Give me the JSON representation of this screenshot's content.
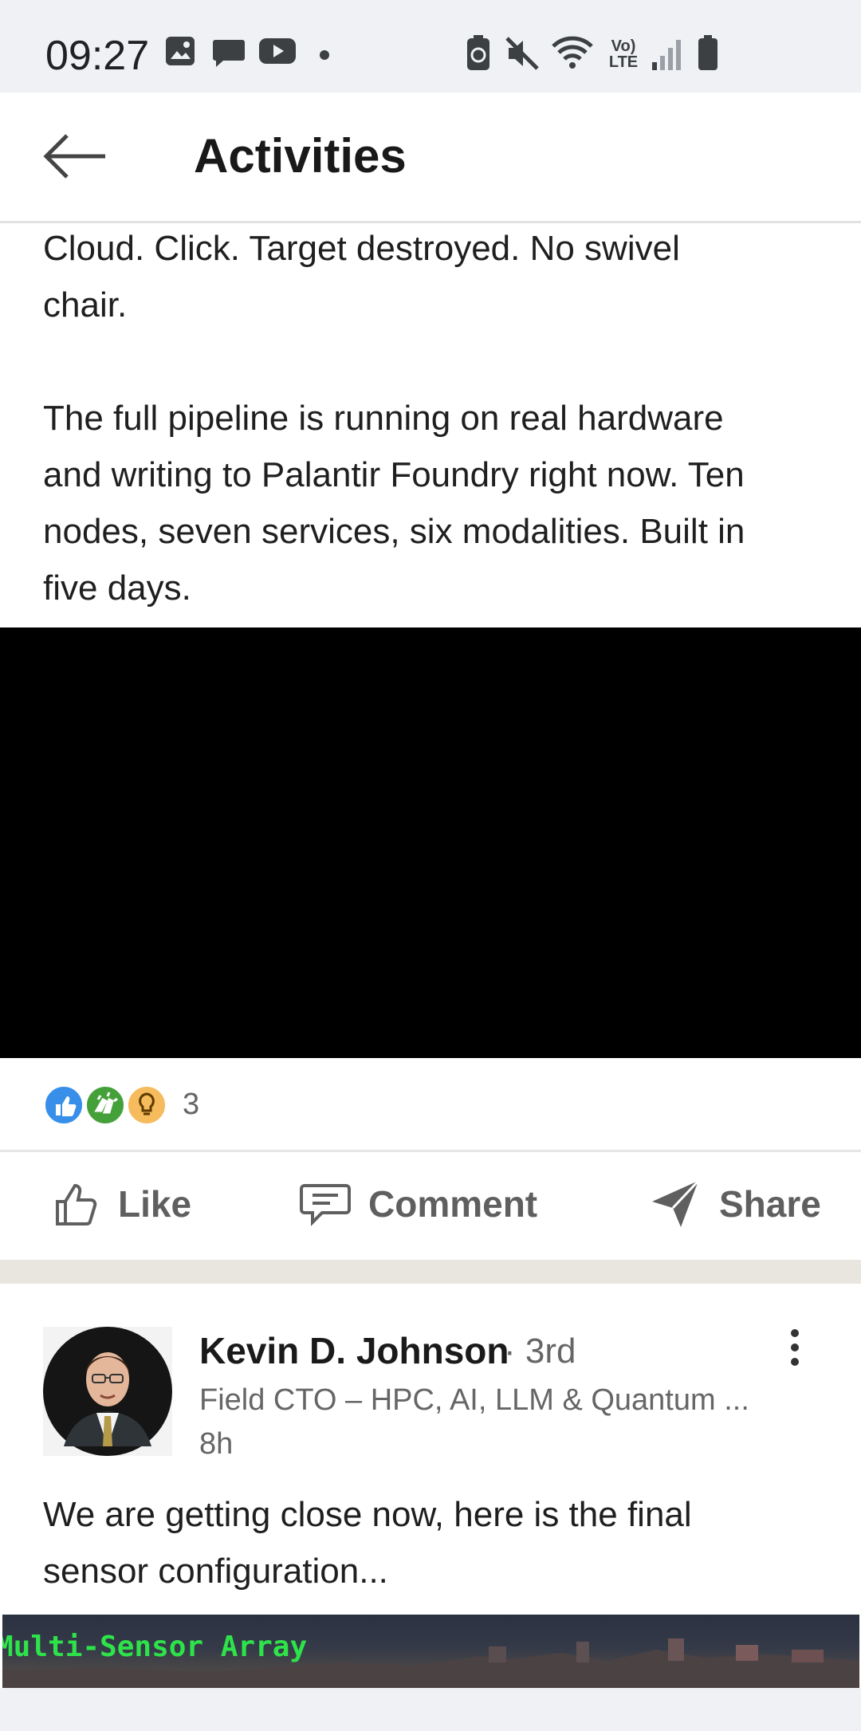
{
  "status_bar": {
    "time": "09:27",
    "network_label": "Vo) LTE",
    "icons": [
      "gallery-icon",
      "chat-icon",
      "youtube-icon",
      "dot-icon",
      "battery-saver-icon",
      "mute-icon",
      "wifi-icon",
      "lte-icon",
      "signal-icon",
      "battery-icon"
    ]
  },
  "header": {
    "title": "Activities",
    "back_icon": "back-arrow-icon"
  },
  "post1": {
    "text_line1": "Cloud. Click. Target destroyed. No swivel",
    "text_line2": "chair.",
    "paragraph2": [
      "The full pipeline is running on real hardware",
      "and writing to Palantir Foundry right now. Ten",
      "nodes, seven services, six modalities. Built in",
      "five days."
    ],
    "reactions": {
      "icons": [
        "like-reaction-icon",
        "celebrate-reaction-icon",
        "insightful-reaction-icon"
      ],
      "count": "3"
    },
    "actions": {
      "like": "Like",
      "comment": "Comment",
      "share": "Share"
    }
  },
  "post2": {
    "author": "Kevin D. Johnson",
    "degree": "· 3rd",
    "headline": "Field CTO – HPC, AI, LLM & Quantum ...",
    "time": "8h",
    "text": [
      "We are getting close now, here is the final",
      "sensor configuration..."
    ],
    "image_caption": "Multi-Sensor Array"
  },
  "colors": {
    "accent_blue": "#378fe9",
    "text": "#1f1f1f",
    "muted": "#666666",
    "separator": "#e9e6df"
  }
}
